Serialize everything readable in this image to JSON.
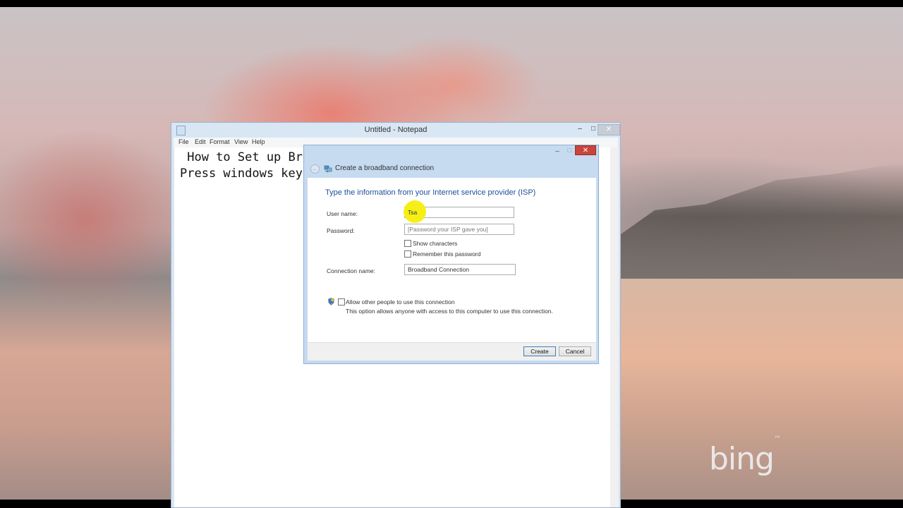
{
  "desktop": {
    "logo_text": "bing",
    "logo_mark": "™"
  },
  "notepad": {
    "title": "Untitled - Notepad",
    "controls": {
      "minimize": "–",
      "maximize": "□",
      "close": "✕"
    },
    "menu": [
      "File",
      "Edit",
      "Format",
      "View",
      "Help"
    ],
    "lines": [
      " How to Set up Br",
      "Press windows key"
    ]
  },
  "dialog": {
    "title": "Create a broadband connection",
    "controls": {
      "minimize": "–",
      "maximize": "□",
      "close": "✕",
      "back": "←"
    },
    "heading": "Type the information from your Internet service provider (ISP)",
    "username": {
      "label": "User name:",
      "value": "Tsa"
    },
    "password": {
      "label": "Password:",
      "placeholder": "[Password your ISP gave you]"
    },
    "show_characters": {
      "label": "Show characters",
      "checked": false
    },
    "remember_password": {
      "label": "Remember this password",
      "checked": false
    },
    "connection_name": {
      "label": "Connection name:",
      "value": "Broadband Connection"
    },
    "allow_others": {
      "label": "Allow other people to use this connection",
      "description": "This option allows anyone with access to this computer to use this connection.",
      "checked": false
    },
    "buttons": {
      "create": "Create",
      "cancel": "Cancel"
    }
  }
}
